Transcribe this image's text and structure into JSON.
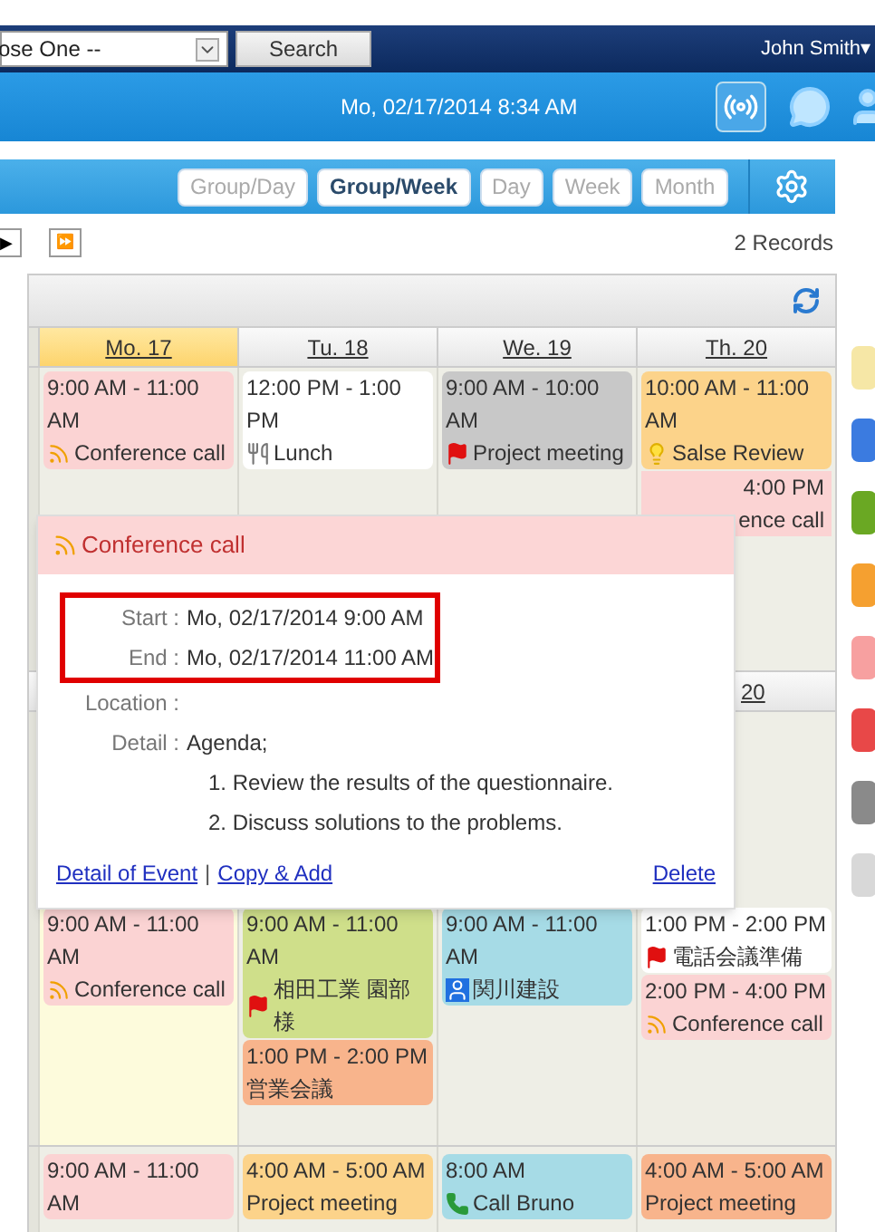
{
  "top_bar": {
    "select": {
      "value": "ose One --"
    },
    "search_button": "Search",
    "user": "John Smith▾"
  },
  "date_bar": {
    "datetime": "Mo, 02/17/2014 8:34 AM"
  },
  "views": [
    {
      "label": "Group/Day",
      "selected": false
    },
    {
      "label": "Group/Week",
      "selected": true
    },
    {
      "label": "Day",
      "selected": false
    },
    {
      "label": "Week",
      "selected": false
    },
    {
      "label": "Month",
      "selected": false
    }
  ],
  "nav": {
    "buttons": [
      "▶",
      "⏩"
    ],
    "records": "2 Records"
  },
  "days": [
    {
      "label": "Mo. 17",
      "selected": true
    },
    {
      "label": "Tu. 18",
      "selected": false
    },
    {
      "label": "We. 19",
      "selected": false
    },
    {
      "label": "Th. 20",
      "selected": false
    }
  ],
  "week1": [
    [
      {
        "time": "9:00 AM - 11:00 AM",
        "title": "Conference call",
        "kind": "call",
        "color": "#fbd3d3"
      }
    ],
    [
      {
        "time": "12:00 PM - 1:00 PM",
        "title": "Lunch",
        "kind": "meal",
        "color": "#ffffff"
      }
    ],
    [
      {
        "time": "9:00 AM - 10:00 AM",
        "title": "Project meeting",
        "kind": "meeting",
        "color": "#c8c8c8"
      }
    ],
    [
      {
        "time": "10:00 AM - 11:00 AM",
        "title": "Salse Review",
        "kind": "idea",
        "color": "#fcd38a"
      },
      {
        "time": "4:00 PM",
        "title": "ence call",
        "kind": "fragment",
        "color": "#fbd3d3"
      }
    ]
  ],
  "week2_header": "20",
  "week2": [
    [
      {
        "time": "9:00 AM - 11:00 AM",
        "title": "Conference call",
        "kind": "call",
        "color": "#fbd3d3"
      }
    ],
    [
      {
        "time": "9:00 AM - 11:00 AM",
        "title": "相田工業 園部様",
        "kind": "meeting",
        "color": "#cfdf8a"
      },
      {
        "time": "1:00 PM - 2:00 PM",
        "title": "営業会議",
        "kind": "none",
        "color": "#f8b48c"
      }
    ],
    [
      {
        "time": "9:00 AM - 11:00 AM",
        "title": "関川建設",
        "kind": "visit",
        "color": "#a6dbe6"
      }
    ],
    [
      {
        "time": "1:00 PM - 2:00 PM",
        "title": "電話会議準備",
        "kind": "meeting",
        "color": "#ffffff"
      },
      {
        "time": "2:00 PM - 4:00 PM",
        "title": "Conference call",
        "kind": "call",
        "color": "#fbd3d3"
      }
    ]
  ],
  "week3": [
    [
      {
        "time": "9:00 AM - 11:00 AM",
        "kind": "none",
        "color": "#fbd3d3"
      }
    ],
    [
      {
        "time": "4:00 AM - 5:00 AM",
        "title": "Project meeting",
        "kind": "none",
        "color": "#fcd38a"
      }
    ],
    [
      {
        "time": "8:00 AM",
        "title": "Call Bruno",
        "kind": "phone",
        "color": "#a6dbe6"
      }
    ],
    [
      {
        "time": "4:00 AM - 5:00 AM",
        "title": "Project meeting",
        "kind": "none",
        "color": "#f8b48c"
      }
    ]
  ],
  "popup": {
    "title": "Conference call",
    "fields": [
      {
        "label": "Start :",
        "value": "Mo, 02/17/2014 9:00 AM",
        "highlighted": true
      },
      {
        "label": "End :",
        "value": "Mo, 02/17/2014 11:00 AM",
        "highlighted": true
      },
      {
        "label": "Location :",
        "highlighted": false
      }
    ],
    "detail_label": "Detail :",
    "detail_lines": [
      "Agenda;",
      "1. Review the results of the questionnaire.",
      "2. Discuss solutions to the problems."
    ],
    "links": [
      "Detail of Event",
      "Copy & Add"
    ],
    "separator": "|",
    "delete": "Delete"
  },
  "legend": [
    {
      "color": "#f6e7a6"
    },
    {
      "color": "#3b7be0"
    },
    {
      "color": "#6aa823"
    },
    {
      "color": "#f5a030"
    },
    {
      "color": "#f7a0a0"
    },
    {
      "color": "#e84848"
    },
    {
      "color": "#8a8a8a"
    },
    {
      "color": "#d8d8d8"
    }
  ]
}
